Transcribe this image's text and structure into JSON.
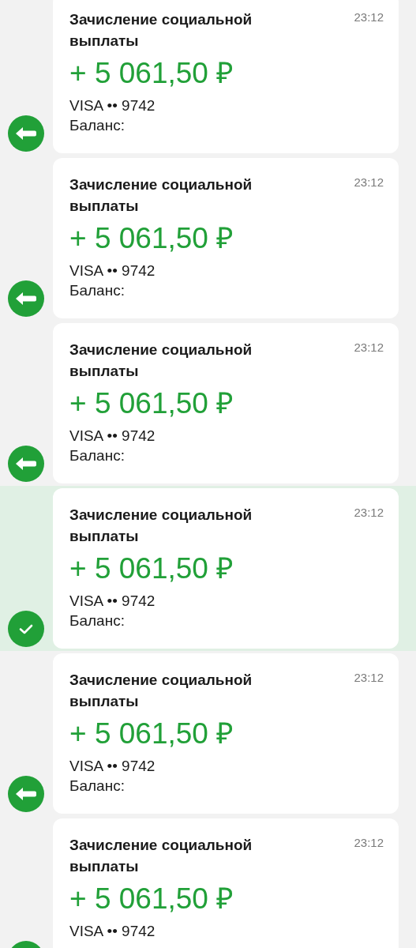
{
  "messages": [
    {
      "title": "Зачисление социальной выплаты",
      "time": "23:12",
      "amount": "+ 5 061,50 ₽",
      "card": "VISA •• 9742",
      "balance": "Баланс:",
      "selected": false
    },
    {
      "title": "Зачисление социальной выплаты",
      "time": "23:12",
      "amount": "+ 5 061,50 ₽",
      "card": "VISA •• 9742",
      "balance": "Баланс:",
      "selected": false
    },
    {
      "title": "Зачисление социальной выплаты",
      "time": "23:12",
      "amount": "+ 5 061,50 ₽",
      "card": "VISA •• 9742",
      "balance": "Баланс:",
      "selected": false
    },
    {
      "title": "Зачисление социальной выплаты",
      "time": "23:12",
      "amount": "+ 5 061,50 ₽",
      "card": "VISA •• 9742",
      "balance": "Баланс:",
      "selected": true
    },
    {
      "title": "Зачисление социальной выплаты",
      "time": "23:12",
      "amount": "+ 5 061,50 ₽",
      "card": "VISA •• 9742",
      "balance": "Баланс:",
      "selected": false
    },
    {
      "title": "Зачисление социальной выплаты",
      "time": "23:12",
      "amount": "+ 5 061,50 ₽",
      "card": "VISA •• 9742",
      "selected": false
    }
  ]
}
